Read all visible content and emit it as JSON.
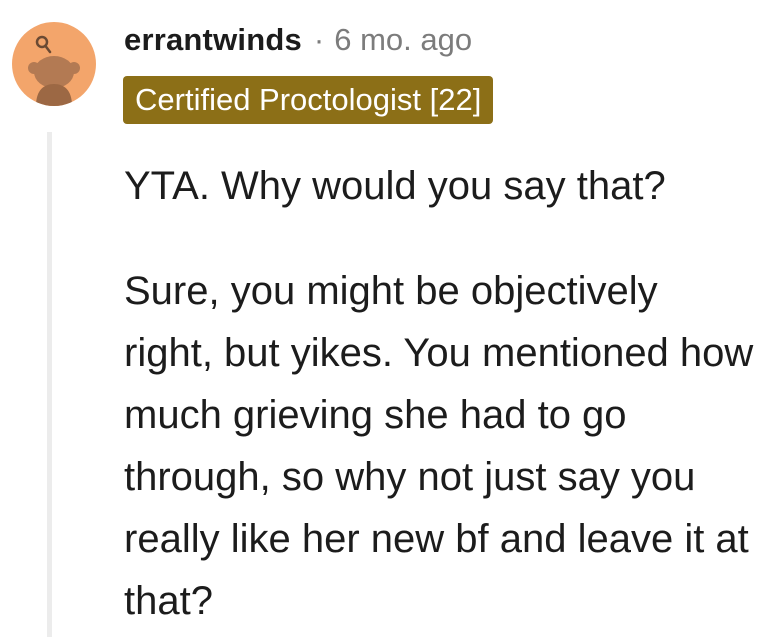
{
  "comment": {
    "username": "errantwinds",
    "separator": "·",
    "timestamp": "6 mo. ago",
    "flair": {
      "text": "Certified Proctologist [22]",
      "background": "#8c6f17",
      "color": "#ffffff"
    },
    "avatar": {
      "icon": "snoo-avatar-icon",
      "background": "#f3a56b"
    },
    "paragraphs": [
      "YTA. Why would you say that?",
      "Sure, you might be objectively right, but yikes. You mentioned how much grieving she had to go through, so why not just say you really like her new bf and leave it at that?"
    ]
  }
}
